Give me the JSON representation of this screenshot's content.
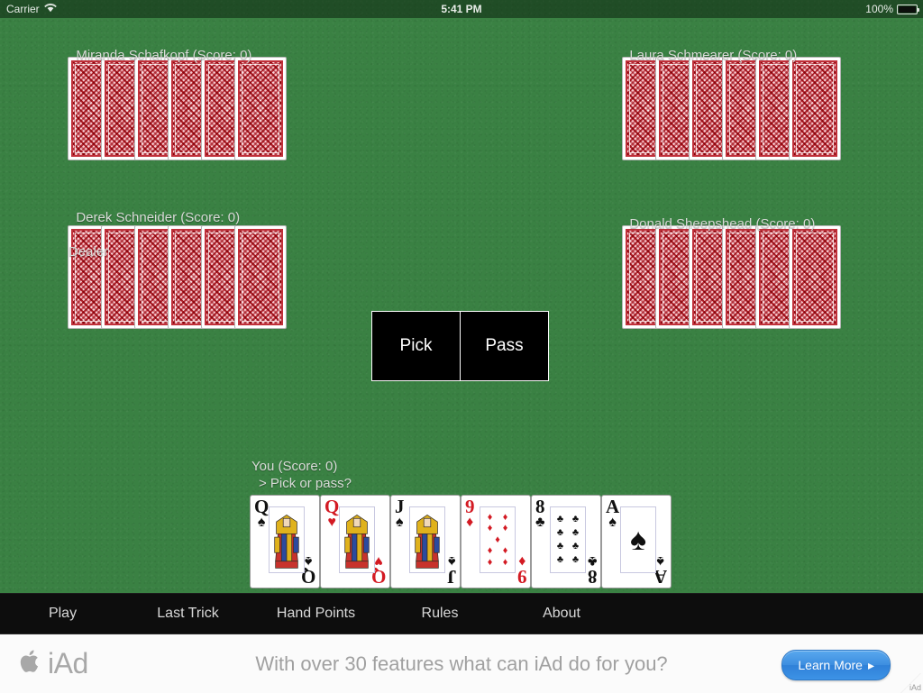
{
  "statusbar": {
    "carrier": "Carrier",
    "wifi_icon": "wifi-icon",
    "time": "5:41 PM",
    "battery_percent": "100%",
    "battery_icon": "battery-full-icon"
  },
  "table": {
    "felt_color": "#3a8143",
    "players": [
      {
        "id": "miranda",
        "name_line": "Miranda Schafkopf (Score: 0)",
        "sub_line": "",
        "card_count": 6,
        "cards_face": "down"
      },
      {
        "id": "laura",
        "name_line": "Laura Schmearer (Score: 0)",
        "sub_line": "",
        "card_count": 6,
        "cards_face": "down"
      },
      {
        "id": "derek",
        "name_line": "Derek Schneider (Score: 0)",
        "sub_line": "Dealer",
        "card_count": 6,
        "cards_face": "down"
      },
      {
        "id": "donald",
        "name_line": "Donald Sheepshead (Score: 0)",
        "sub_line": "",
        "card_count": 6,
        "cards_face": "down"
      }
    ],
    "choice_buttons": [
      {
        "id": "pick",
        "label": "Pick"
      },
      {
        "id": "pass",
        "label": "Pass"
      }
    ],
    "you": {
      "name_line": "You (Score: 0)",
      "prompt_line": "> Pick or pass?",
      "hand": [
        {
          "rank": "Q",
          "suit": "♠",
          "suit_name": "spades",
          "color": "black",
          "kind": "face"
        },
        {
          "rank": "Q",
          "suit": "♥",
          "suit_name": "hearts",
          "color": "red",
          "kind": "face"
        },
        {
          "rank": "J",
          "suit": "♠",
          "suit_name": "spades",
          "color": "black",
          "kind": "face"
        },
        {
          "rank": "9",
          "suit": "♦",
          "suit_name": "diamonds",
          "color": "red",
          "kind": "pips",
          "pip_count": 9
        },
        {
          "rank": "8",
          "suit": "♣",
          "suit_name": "clubs",
          "color": "black",
          "kind": "pips",
          "pip_count": 8
        },
        {
          "rank": "A",
          "suit": "♠",
          "suit_name": "spades",
          "color": "black",
          "kind": "ace"
        }
      ]
    }
  },
  "tabbar": {
    "items": [
      {
        "id": "play",
        "label": "Play",
        "selected": true
      },
      {
        "id": "last-trick",
        "label": "Last Trick",
        "selected": false
      },
      {
        "id": "hand-points",
        "label": "Hand Points",
        "selected": false
      },
      {
        "id": "rules",
        "label": "Rules",
        "selected": false
      },
      {
        "id": "about",
        "label": "About",
        "selected": false
      }
    ]
  },
  "ad": {
    "brand": "iAd",
    "apple_icon": "apple-logo-icon",
    "headline": "With over 30 features what can iAd do for you?",
    "cta_label": "Learn More",
    "cta_arrow": "▸",
    "corner_label": "iAd",
    "cta_color": "#3d8ee0"
  }
}
